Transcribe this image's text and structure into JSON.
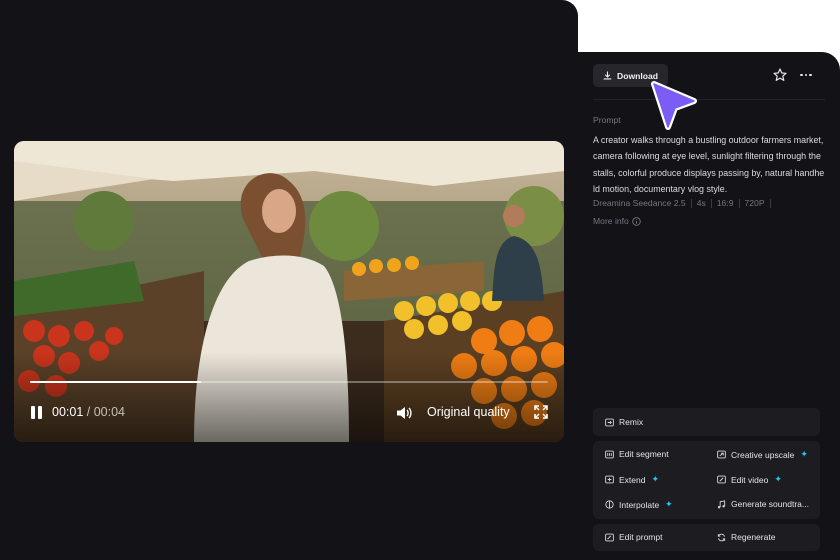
{
  "player": {
    "current_time": "00:01",
    "total_time": "/ 00:04",
    "progress": 0.33,
    "quality_label": "Original quality"
  },
  "header": {
    "download_label": "Download"
  },
  "details": {
    "prompt_label": "Prompt",
    "prompt_text": "A creator walks through a bustling outdoor farmers market, camera following at eye level, sunlight filtering through the stalls, colorful produce displays passing by, natural handheld motion, documentary vlog style.",
    "model": "Dreamina Seedance 2.5",
    "duration": "4s",
    "ratio": "16:9",
    "resolution": "720P",
    "more_info_label": "More info"
  },
  "actions": {
    "remix": "Remix",
    "edit_segment": "Edit segment",
    "creative_upscale": "Creative upscale",
    "extend": "Extend",
    "edit_video": "Edit video",
    "interpolate": "Interpolate",
    "generate_soundtrack": "Generate soundtra...",
    "edit_prompt": "Edit prompt",
    "regenerate": "Regenerate"
  },
  "colors": {
    "panel_bg": "#121217",
    "card_bg": "#1c1c21",
    "accent_spark": "#22c8ee",
    "cursor_fill": "#7b5cf5"
  }
}
